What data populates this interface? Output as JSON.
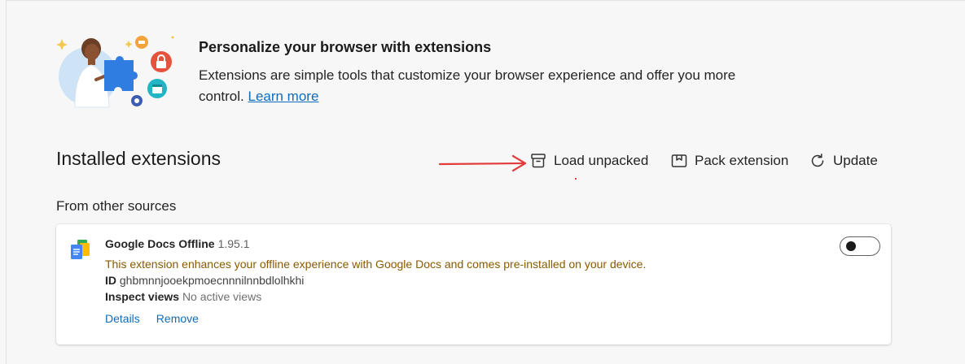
{
  "hero": {
    "title": "Personalize your browser with extensions",
    "description": "Extensions are simple tools that customize your browser experience and offer you more control.",
    "link_label": "Learn more"
  },
  "installed": {
    "title": "Installed extensions",
    "toolbar": {
      "load_unpacked": "Load unpacked",
      "pack_extension": "Pack extension",
      "update": "Update"
    },
    "from_other_sources": "From other sources"
  },
  "extension": {
    "name": "Google Docs Offline",
    "version": "1.95.1",
    "note": "This extension enhances your offline experience with Google Docs and comes pre-installed on your device.",
    "id_label": "ID",
    "id_value": "ghbmnnjooekpmoecnnnilnnbdlolhkhi",
    "inspect_label": "Inspect views",
    "inspect_value": "No active views",
    "details_label": "Details",
    "remove_label": "Remove",
    "enabled": false,
    "icon": "google-docs-offline-icon"
  },
  "colors": {
    "link": "#0f6cbd",
    "warning_text": "#8a5a00",
    "annotation_arrow": "#e23b3b"
  }
}
